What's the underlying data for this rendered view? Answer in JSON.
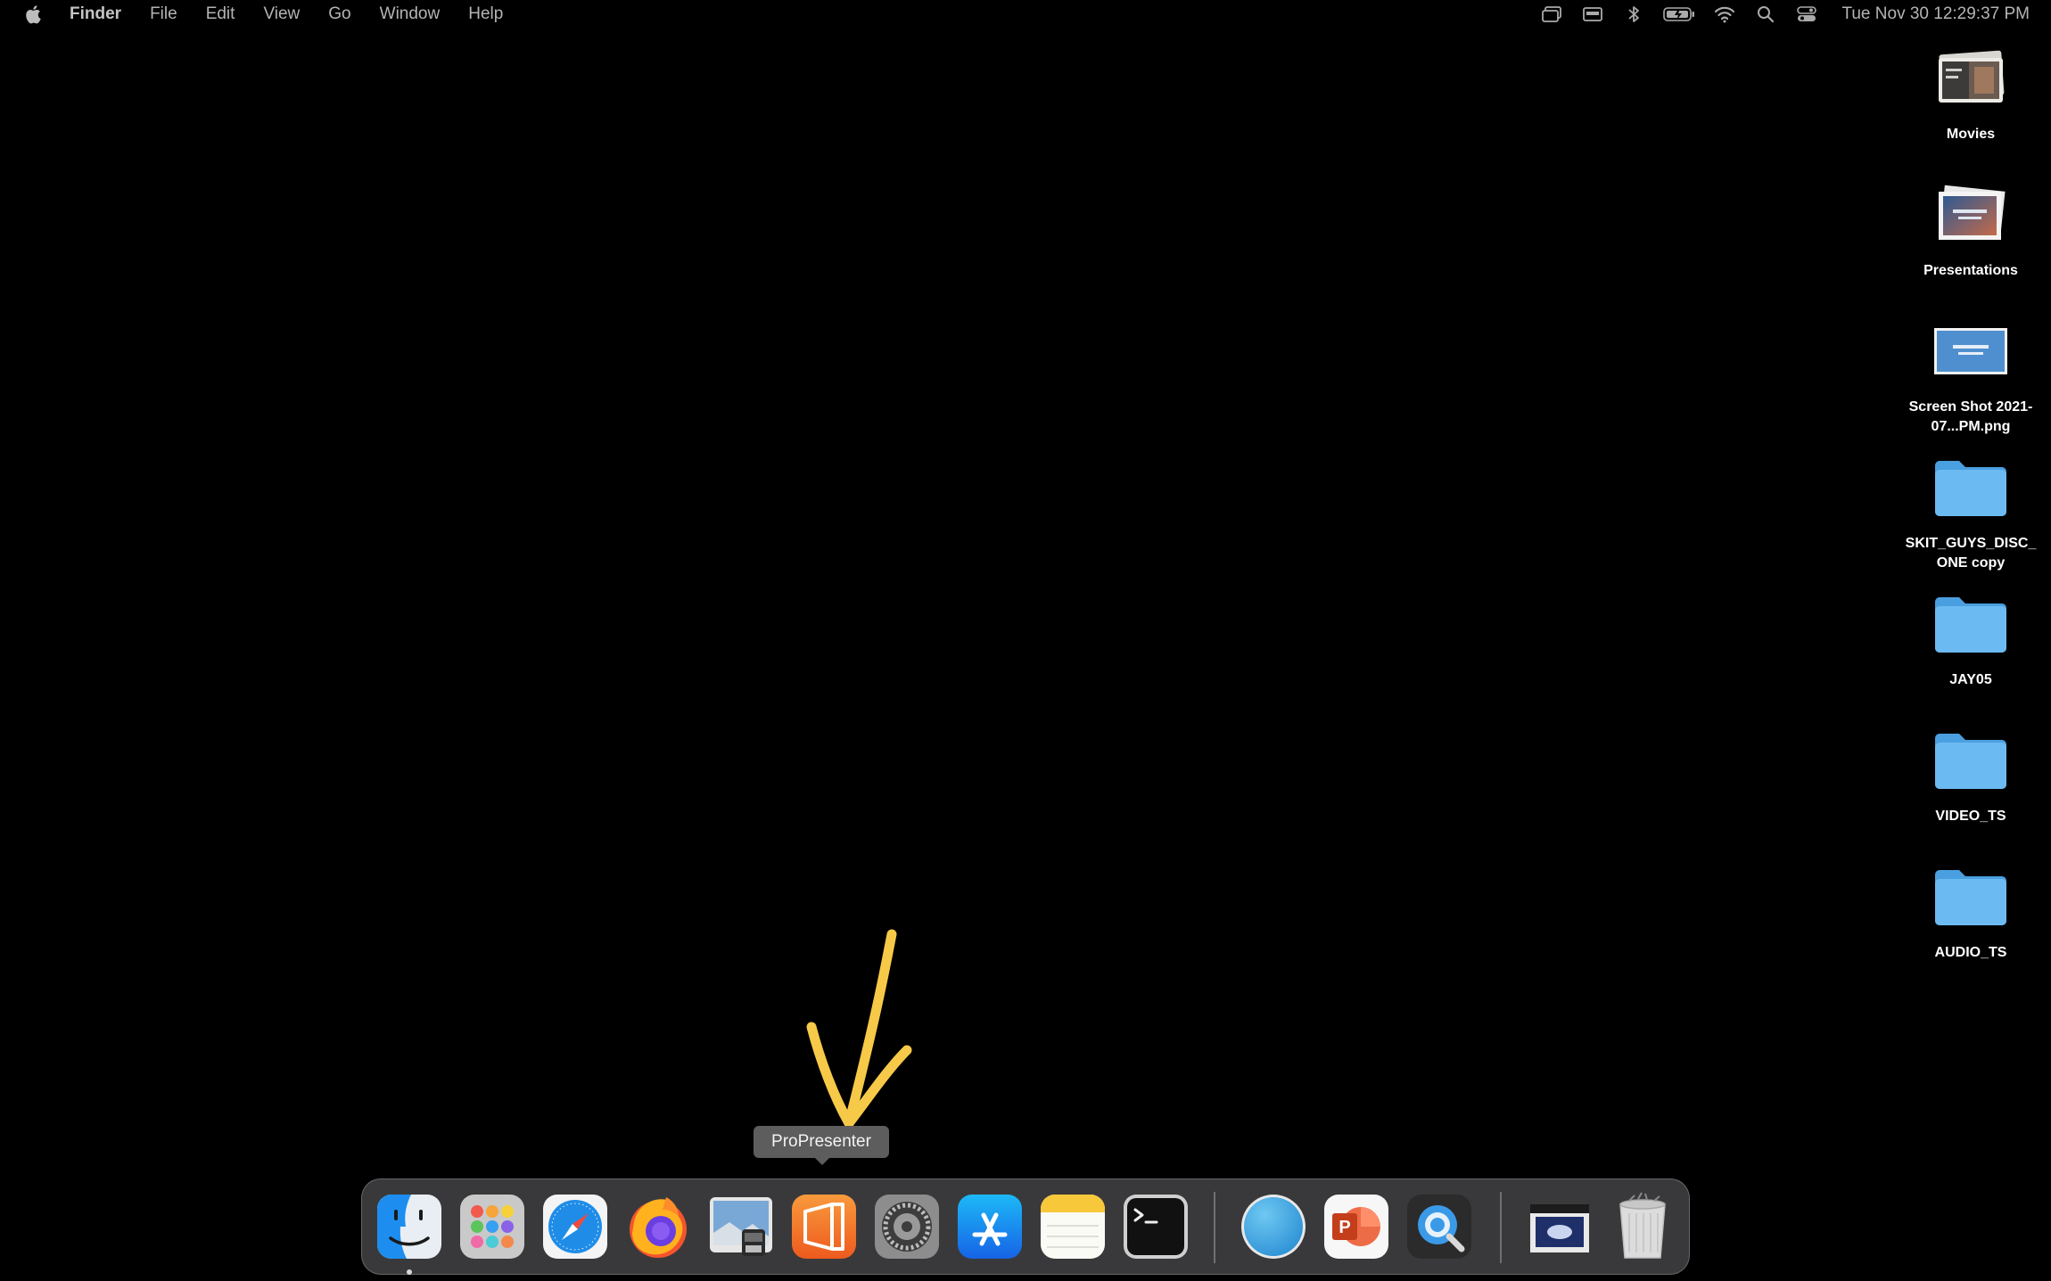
{
  "menubar": {
    "app_name": "Finder",
    "items": [
      "File",
      "Edit",
      "View",
      "Go",
      "Window",
      "Help"
    ],
    "status_icons": [
      "screen-mirroring-icon",
      "display-icon",
      "bluetooth-icon",
      "battery-icon",
      "wifi-icon",
      "spotlight-search-icon",
      "control-center-icon"
    ],
    "clock": "Tue Nov 30  12:29:37 PM"
  },
  "desktop_icons": [
    {
      "label": "Movies",
      "kind": "folder-thumbnail"
    },
    {
      "label": "Presentations",
      "kind": "folder-thumbnail"
    },
    {
      "label": "Screen Shot 2021-07...PM.png",
      "kind": "image"
    },
    {
      "label": "SKIT_GUYS_DISC_ ONE copy",
      "kind": "folder"
    },
    {
      "label": "JAY05",
      "kind": "folder"
    },
    {
      "label": "VIDEO_TS",
      "kind": "folder"
    },
    {
      "label": "AUDIO_TS",
      "kind": "folder"
    }
  ],
  "dock": {
    "tooltip": "ProPresenter",
    "apps": [
      "Finder",
      "Launchpad",
      "Safari",
      "Firefox",
      "Preview",
      "ProPresenter",
      "System Preferences",
      "App Store",
      "Notes",
      "Terminal",
      "Blue Circle App",
      "Microsoft PowerPoint",
      "QuickTime Player",
      "Screen Shot Stack",
      "Trash"
    ]
  },
  "colors": {
    "folder_blue": "#5fb4ee",
    "annotation_yellow": "#f7c948",
    "dock_bg": "#464648"
  }
}
